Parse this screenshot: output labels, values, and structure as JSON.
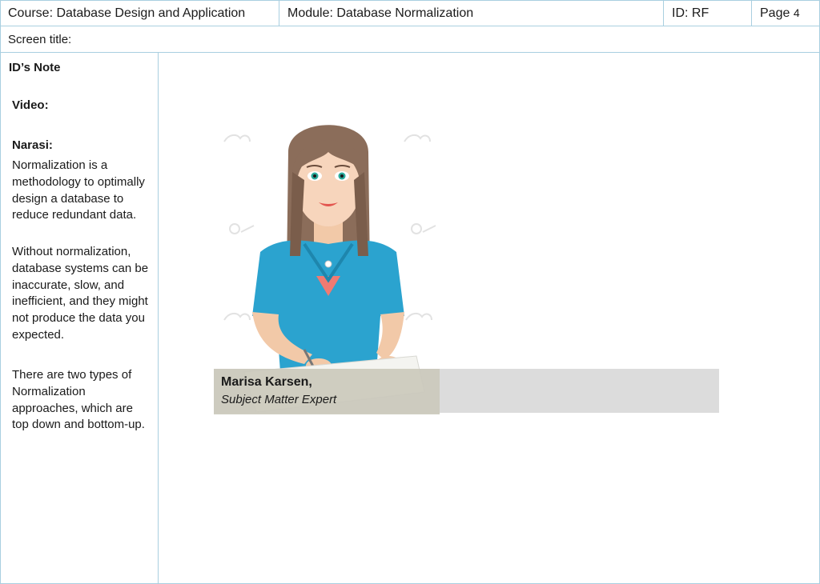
{
  "header": {
    "course": "Course:  Database Design and Application",
    "module": "Module: Database Normalization",
    "id": "ID: RF",
    "page_label": "Page",
    "page_number": "4"
  },
  "screen_title_label": "Screen title:",
  "notes": {
    "title": "ID’s Note",
    "video_label": "Video:",
    "narasi_label": "Narasi:",
    "para1": "Normalization is a methodology  to optimally design a database to reduce redundant data.",
    "para2": "Without normalization, database systems can be inaccurate, slow, and inefficient, and they might not produce the data you expected.",
    "para3": "There are two types of Normalization approaches, which are top down and bottom-up."
  },
  "caption": {
    "name": "Marisa Karsen,",
    "role": "Subject Matter Expert"
  },
  "colors": {
    "border": "#a9cfe0",
    "shirt": "#2ba3cf",
    "hair": "#8b6d5a",
    "caption_bar": "#dcdcdc"
  },
  "icons": [
    "watermark-icon",
    "presenter-illustration"
  ]
}
